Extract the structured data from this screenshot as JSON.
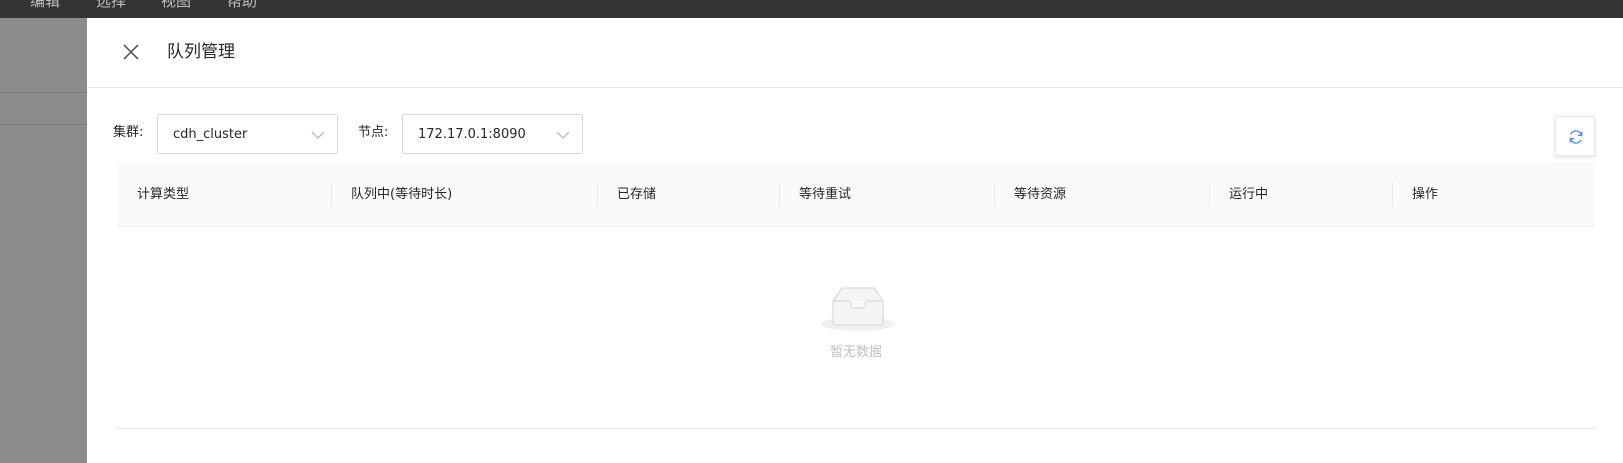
{
  "menubar": {
    "items": [
      "编辑",
      "选择",
      "视图",
      "帮助"
    ]
  },
  "drawer": {
    "title": "队列管理",
    "close_icon": "close-icon"
  },
  "filters": {
    "cluster_label": "集群:",
    "cluster_value": "cdh_cluster",
    "node_label": "节点:",
    "node_value": "172.17.0.1:8090"
  },
  "toolbar": {
    "refresh_icon": "refresh-icon"
  },
  "table": {
    "columns": [
      "计算类型",
      "队列中(等待时长)",
      "已存储",
      "等待重试",
      "等待资源",
      "运行中",
      "操作"
    ],
    "rows": [],
    "empty_text": "暂无数据"
  },
  "colors": {
    "menubar_bg": "#333333",
    "backdrop": "#8c8c8c",
    "accent": "#3f87f5",
    "border": "#d9d9d9"
  }
}
